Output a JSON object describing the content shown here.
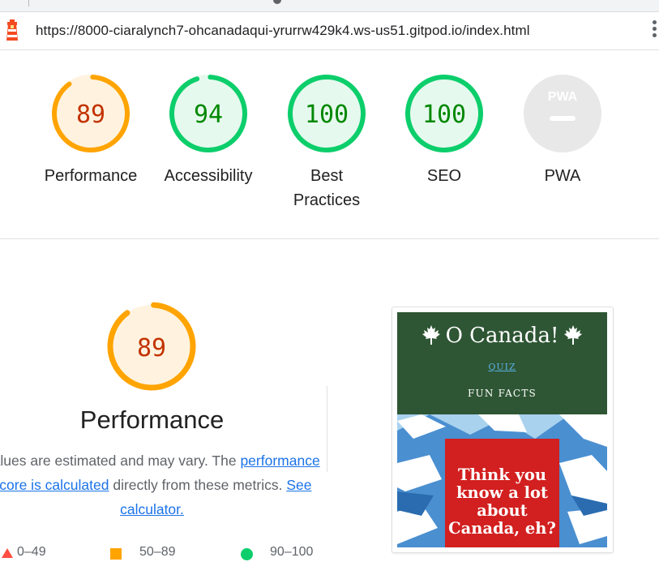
{
  "browser": {
    "url": "https://8000-ciaralynch7-ohcanadaqui-yrurrw429k4.ws-us51.gitpod.io/index.html"
  },
  "scores": [
    {
      "label": "Performance",
      "value": "89",
      "fraction": 0.89,
      "color": "#ffa400",
      "bg": "#fff3e0",
      "text_color": "#c33300"
    },
    {
      "label": "Accessibility",
      "value": "94",
      "fraction": 0.94,
      "color": "#0cce6b",
      "bg": "#e6f9ee",
      "text_color": "#008800"
    },
    {
      "label": "Best Practices",
      "value": "100",
      "fraction": 1.0,
      "color": "#0cce6b",
      "bg": "#e6f9ee",
      "text_color": "#008800"
    },
    {
      "label": "SEO",
      "value": "100",
      "fraction": 1.0,
      "color": "#0cce6b",
      "bg": "#e6f9ee",
      "text_color": "#008800"
    },
    {
      "label": "PWA",
      "value": "",
      "color": "#e0e0e0",
      "bg": "#e8e8e8",
      "badge": "PWA"
    }
  ],
  "performance": {
    "score": "89",
    "fraction": 0.89,
    "title": "Performance",
    "desc_before": "Values are estimated and may vary. The ",
    "link1": "performance score is calculated",
    "desc_middle": " directly from these metrics. ",
    "link2": "See calculator."
  },
  "legend": [
    {
      "range": "0–49",
      "color": "#ff4e42",
      "shape": "triangle"
    },
    {
      "range": "50–89",
      "color": "#ffa400",
      "shape": "square"
    },
    {
      "range": "90–100",
      "color": "#0cce6b",
      "shape": "circle"
    }
  ],
  "thumbnail": {
    "site_title": "O Canada!",
    "nav_quiz": "QUIZ",
    "nav_fun_facts": "FUN FACTS",
    "hero_text": "Think you know a lot about Canada, eh?",
    "header_color": "#2e5634",
    "card_color": "#d21f1f"
  }
}
